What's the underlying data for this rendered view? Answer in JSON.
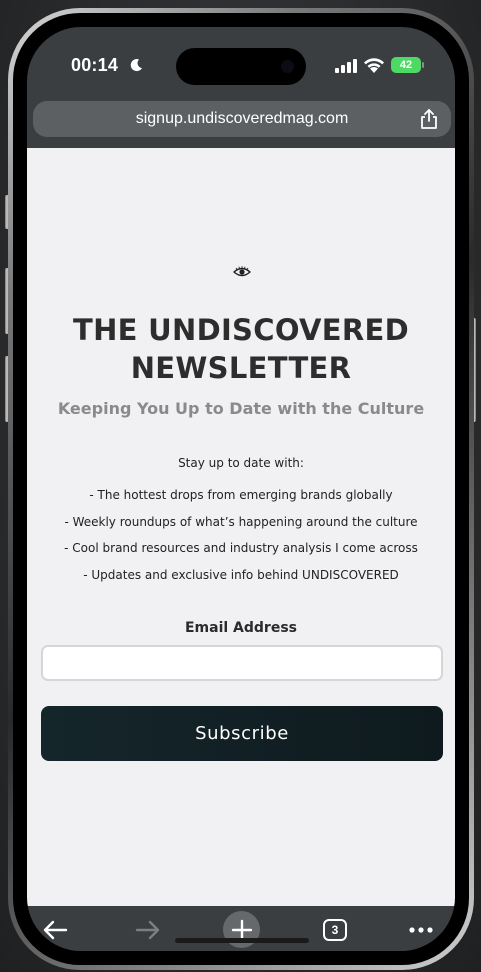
{
  "status_bar": {
    "time": "00:14",
    "battery_level": "42",
    "icons": [
      "moon-icon",
      "signal-icon",
      "wifi-icon",
      "battery-icon"
    ]
  },
  "browser": {
    "url": "signup.undiscoveredmag.com",
    "tab_count": "3",
    "toolbar_icons": [
      "back-arrow-icon",
      "forward-arrow-icon",
      "plus-icon",
      "tabs-icon",
      "more-icon"
    ]
  },
  "newsletter": {
    "title": "THE UNDISCOVERED NEWSLETTER",
    "subtitle": "Keeping You Up to Date with the Culture",
    "intro": "Stay up to date with:",
    "bullets": [
      "-  The hottest drops from emerging brands globally",
      "- Weekly roundups of what’s happening around the culture",
      "- Cool brand resources and industry analysis I come across",
      "- Updates and exclusive info behind UNDISCOVERED"
    ],
    "email_label": "Email Address",
    "email_value": "",
    "subscribe_label": "Subscribe"
  },
  "colors": {
    "page_background": "#f1f1f4",
    "browser_chrome": "#3b3e40",
    "button_dark": "#15262b",
    "battery_green": "#4cd964",
    "subtitle_gray": "#8a8a8a"
  }
}
